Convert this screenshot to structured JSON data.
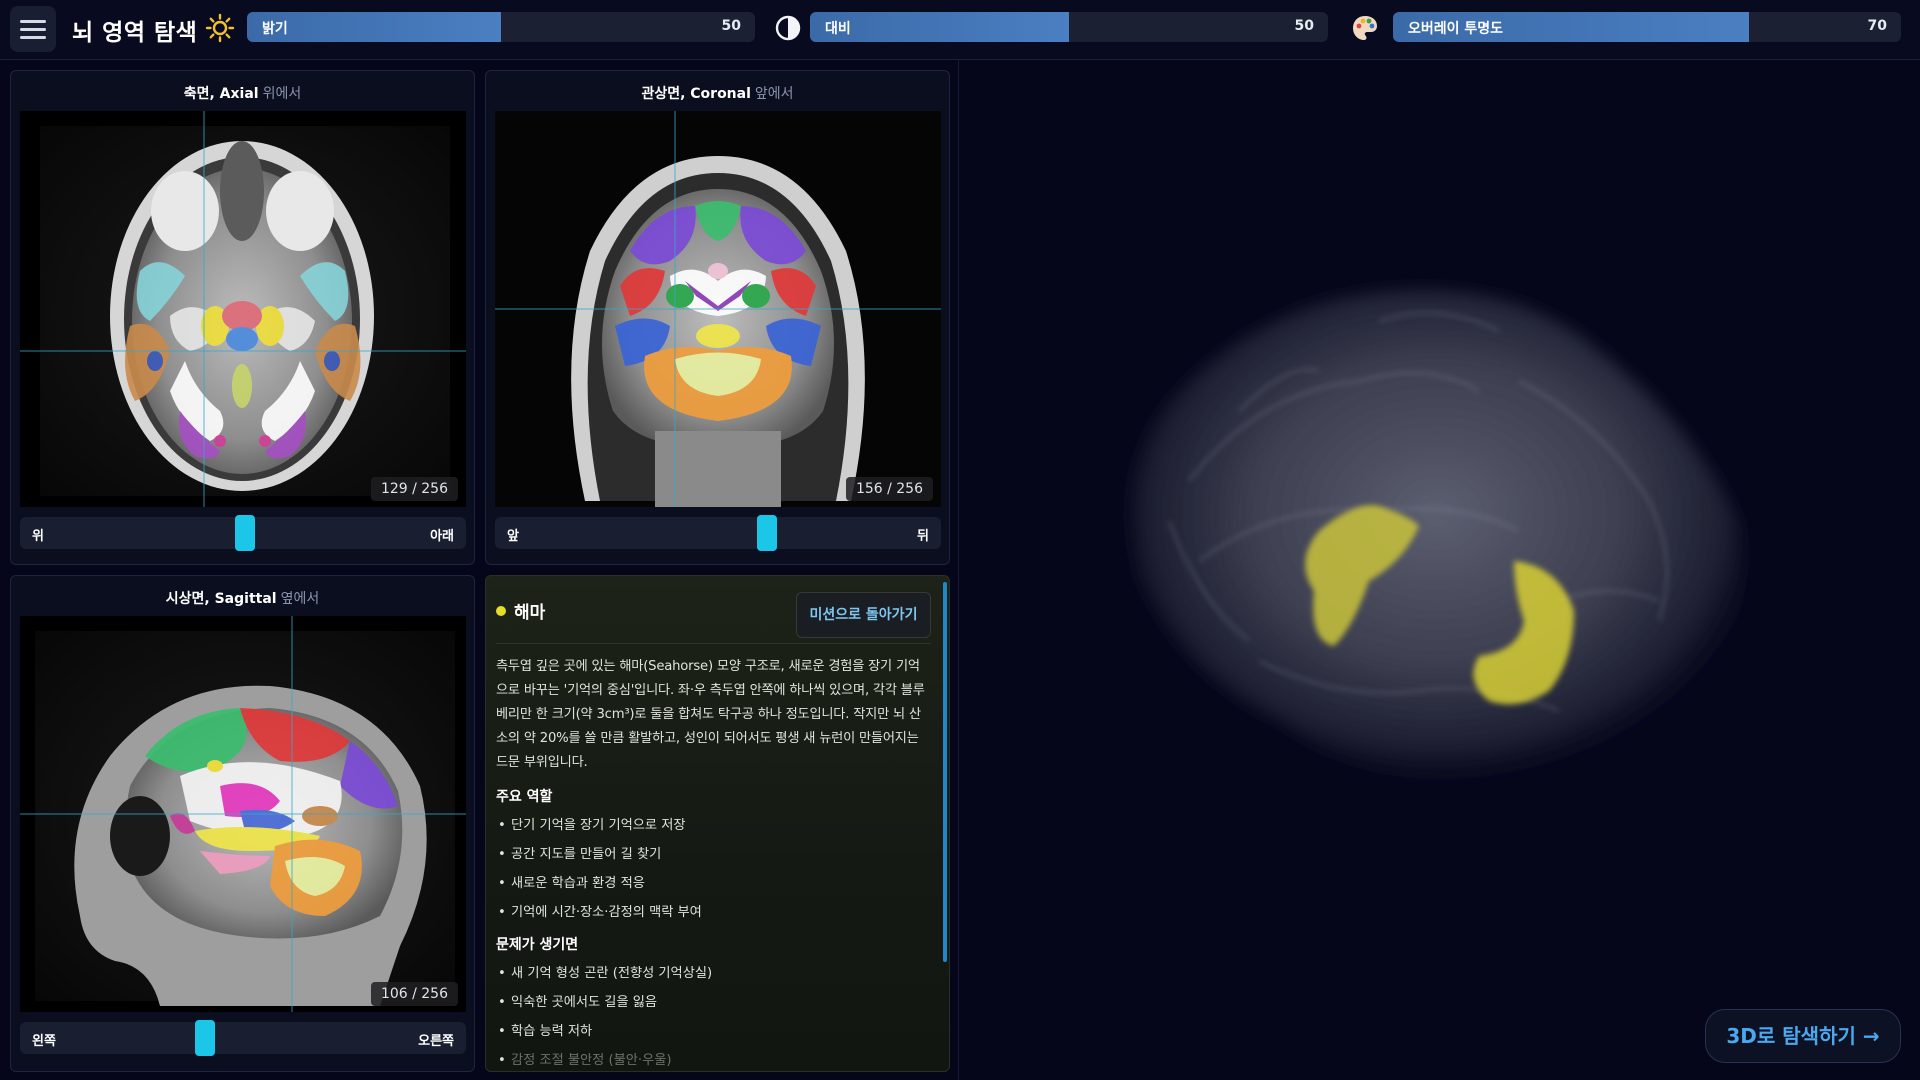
{
  "app": {
    "title": "뇌 영역 탐색"
  },
  "controls": {
    "brightness": {
      "label": "밝기",
      "value": 50,
      "icon": "sun-icon"
    },
    "contrast": {
      "label": "대비",
      "value": 50,
      "icon": "contrast-icon"
    },
    "overlay": {
      "label": "오버레이 투명도",
      "value": 70,
      "icon": "palette-icon"
    }
  },
  "views": {
    "axial": {
      "title": "축면, Axial",
      "subtitle": "위에서",
      "slice": 129,
      "total": 256,
      "slice_text": "129 / 256",
      "left_label": "위",
      "right_label": "아래"
    },
    "coronal": {
      "title": "관상면, Coronal",
      "subtitle": "앞에서",
      "slice": 156,
      "total": 256,
      "slice_text": "156 / 256",
      "left_label": "앞",
      "right_label": "뒤"
    },
    "sagittal": {
      "title": "시상면, Sagittal",
      "subtitle": "옆에서",
      "slice": 106,
      "total": 256,
      "slice_text": "106 / 256",
      "left_label": "왼쪽",
      "right_label": "오른쪽"
    }
  },
  "info": {
    "region": "해마",
    "back_button": "미션으로 돌아가기",
    "description": "측두엽 깊은 곳에 있는 해마(Seahorse) 모양 구조로, 새로운 경험을 장기 기억으로 바꾸는 '기억의 중심'입니다. 좌·우 측두엽 안쪽에 하나씩 있으며, 각각 블루베리만 한 크기(약 3cm³)로 둘을 합쳐도 탁구공 하나 정도입니다. 작지만 뇌 산소의 약 20%를 쓸 만큼 활발하고, 성인이 되어서도 평생 새 뉴런이 만들어지는 드문 부위입니다.",
    "roles_heading": "주요 역할",
    "roles": [
      "단기 기억을 장기 기억으로 저장",
      "공간 지도를 만들어 길 찾기",
      "새로운 학습과 환경 적응",
      "기억에 시간·장소·감정의 맥락 부여"
    ],
    "problems_heading": "문제가 생기면",
    "problems": [
      "새 기억 형성 곤란 (전향성 기억상실)",
      "익숙한 곳에서도 길을 잃음",
      "학습 능력 저하",
      "감정 조절 불안정 (불안·우울)"
    ]
  },
  "view3d": {
    "button": "3D로 탐색하기 →"
  },
  "colors": {
    "accent": "#1cc6e8",
    "highlight": "#e6dc2a",
    "slider_fill": "#4a7fc2"
  }
}
